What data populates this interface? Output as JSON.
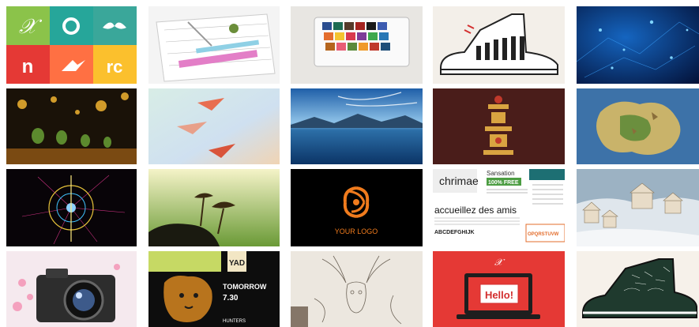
{
  "gallery": {
    "tiles": [
      {
        "icon": "colorful-logo-tiles-icon"
      },
      {
        "icon": "blueprint-desk-icon"
      },
      {
        "icon": "watercolor-palette-icon"
      },
      {
        "icon": "piano-sneaker-icon"
      },
      {
        "icon": "blue-tech-lights-icon"
      },
      {
        "icon": "bokeh-figurines-icon"
      },
      {
        "icon": "paper-planes-icon"
      },
      {
        "icon": "mountain-lake-icon"
      },
      {
        "icon": "steampunk-tower-icon"
      },
      {
        "icon": "fantasy-map-icon"
      },
      {
        "icon": "radial-burst-icon"
      },
      {
        "icon": "mushrooms-silhouette-icon"
      },
      {
        "icon": "your-logo-icon",
        "label": "YOUR LOGO"
      },
      {
        "icon": "typography-specimen-icon",
        "label_top": "Sansation",
        "label_free": "100% FREE",
        "label_word": "chrimae",
        "label_main": "accueillez des amis",
        "label_abc": "ABCDEFGHIJK",
        "label_opq": "OPQRSTUVW"
      },
      {
        "icon": "snowy-village-icon"
      },
      {
        "icon": "camera-hearts-icon"
      },
      {
        "icon": "lion-poster-icon",
        "label": "TOMORROW",
        "label_time": "7.30",
        "label_side": "YAD",
        "label_bottom": "HUNTERS"
      },
      {
        "icon": "pencil-sketch-deer-icon"
      },
      {
        "icon": "hello-laptop-icon",
        "label": "Hello!"
      },
      {
        "icon": "chalk-sneaker-icon"
      }
    ]
  }
}
